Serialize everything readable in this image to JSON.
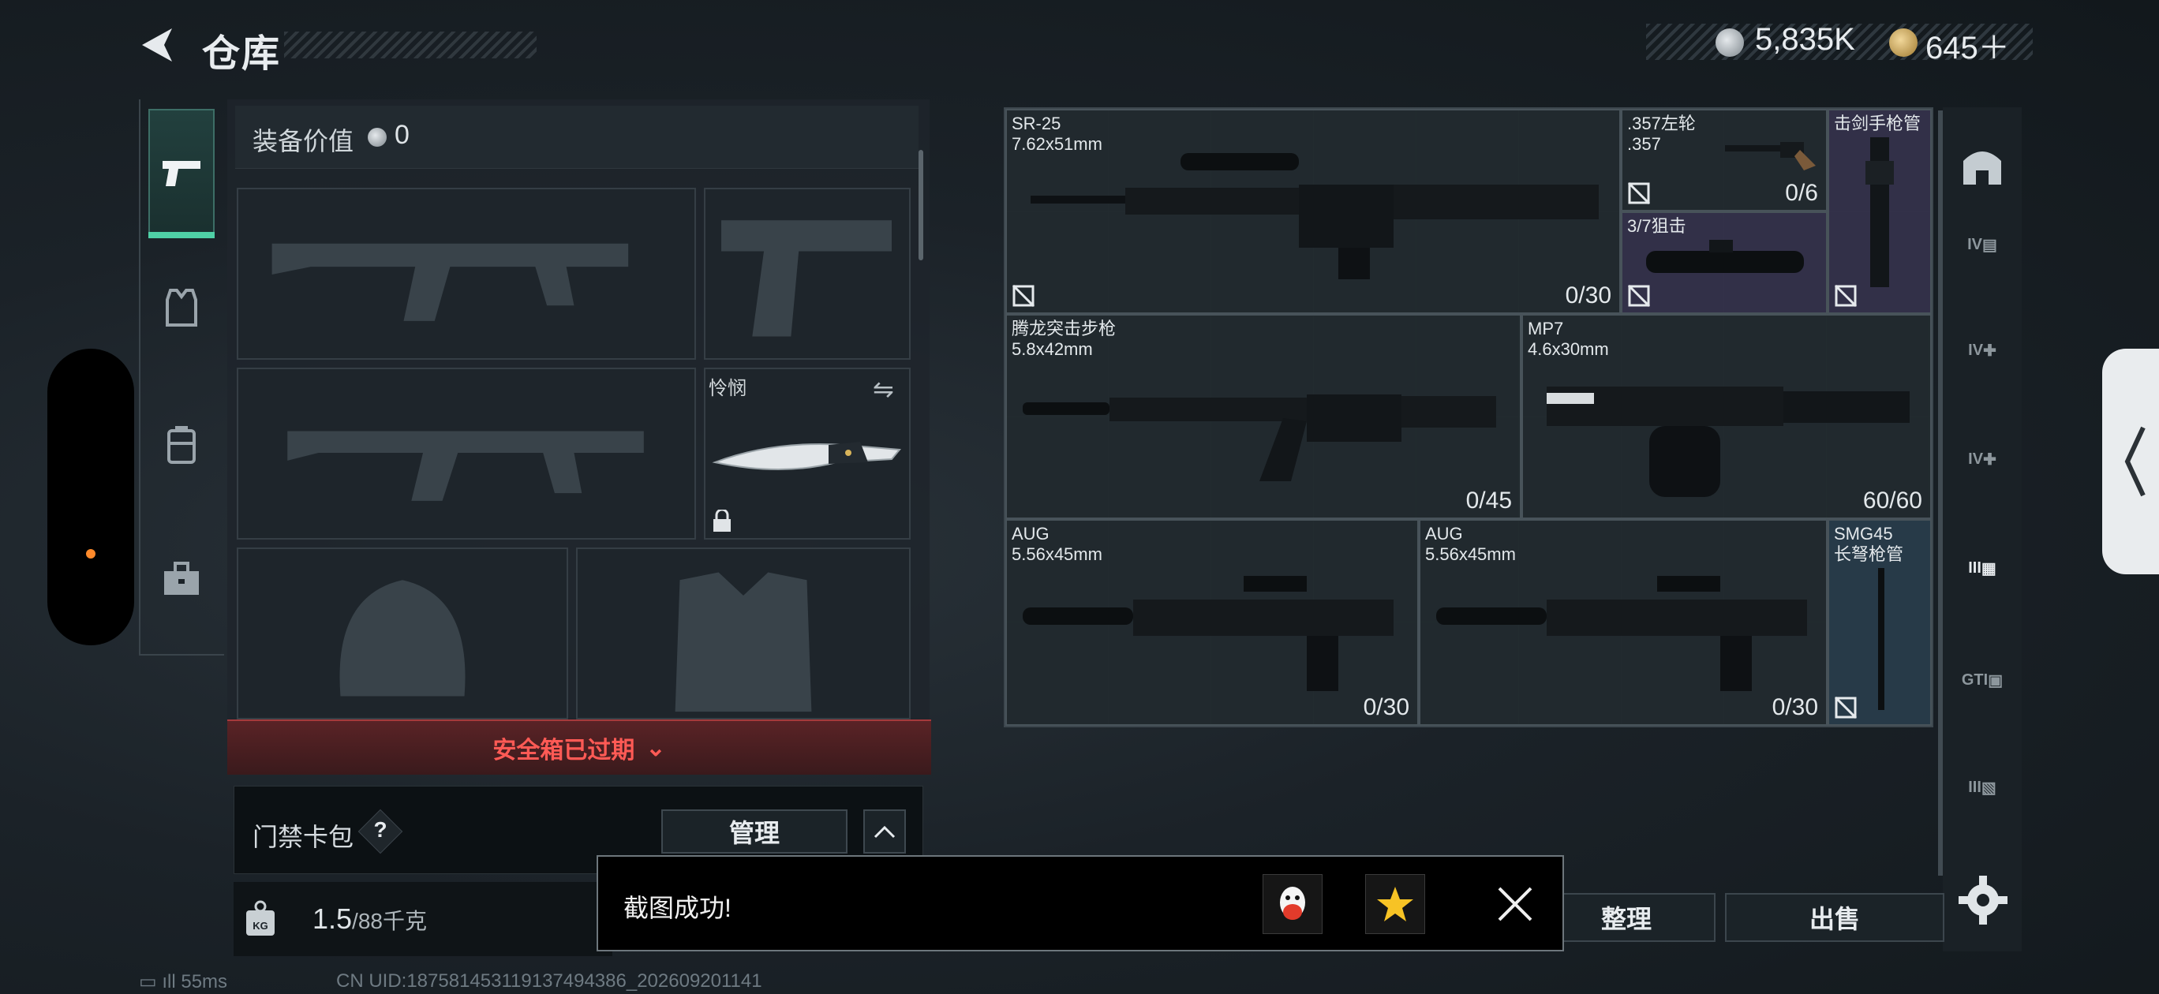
{
  "header": {
    "title": "仓库",
    "currency_silver": "5,835K",
    "currency_gold": "645＋"
  },
  "nav": {
    "items": [
      "weapons",
      "gear",
      "backpack",
      "toolbox"
    ]
  },
  "loadout": {
    "value_label": "装备价值",
    "value": "0",
    "melee_name": "怜悯",
    "safebox_expired": "安全箱已过期",
    "card_pack_label": "门禁卡包",
    "help_symbol": "?",
    "manage_label": "管理",
    "weight_current": "1.5",
    "weight_max": "/88千克"
  },
  "stash": {
    "items": [
      {
        "name": "SR-25",
        "caliber": "7.62x51mm",
        "ammo": "0/30"
      },
      {
        "name": ".357左轮",
        "caliber": ".357",
        "ammo": "0/6"
      },
      {
        "name": "击剑手枪管",
        "caliber": "",
        "ammo": ""
      },
      {
        "name": "3/7狙击",
        "caliber": "",
        "ammo": ""
      },
      {
        "name": "腾龙突击步枪",
        "caliber": "5.8x42mm",
        "ammo": "0/45"
      },
      {
        "name": "MP7",
        "caliber": "4.6x30mm",
        "ammo": "60/60"
      },
      {
        "name": "AUG",
        "caliber": "5.56x45mm",
        "ammo": "0/30"
      },
      {
        "name": "AUG",
        "caliber": "5.56x45mm",
        "ammo": "0/30"
      },
      {
        "name": "SMG45",
        "caliber": "长弩枪管",
        "ammo": ""
      }
    ],
    "sort_label": "整理",
    "sell_label": "出售"
  },
  "right_bar": {
    "labels": [
      "IV",
      "IV",
      "IV",
      "III",
      "GTI",
      "III"
    ]
  },
  "toast": {
    "message": "截图成功!"
  },
  "status": {
    "ping": "55ms",
    "uid": "CN UID:187581453119137494386_202609201141"
  },
  "colors": {
    "accent_green": "#4fd0a6",
    "expired_red": "#ff5a55"
  }
}
